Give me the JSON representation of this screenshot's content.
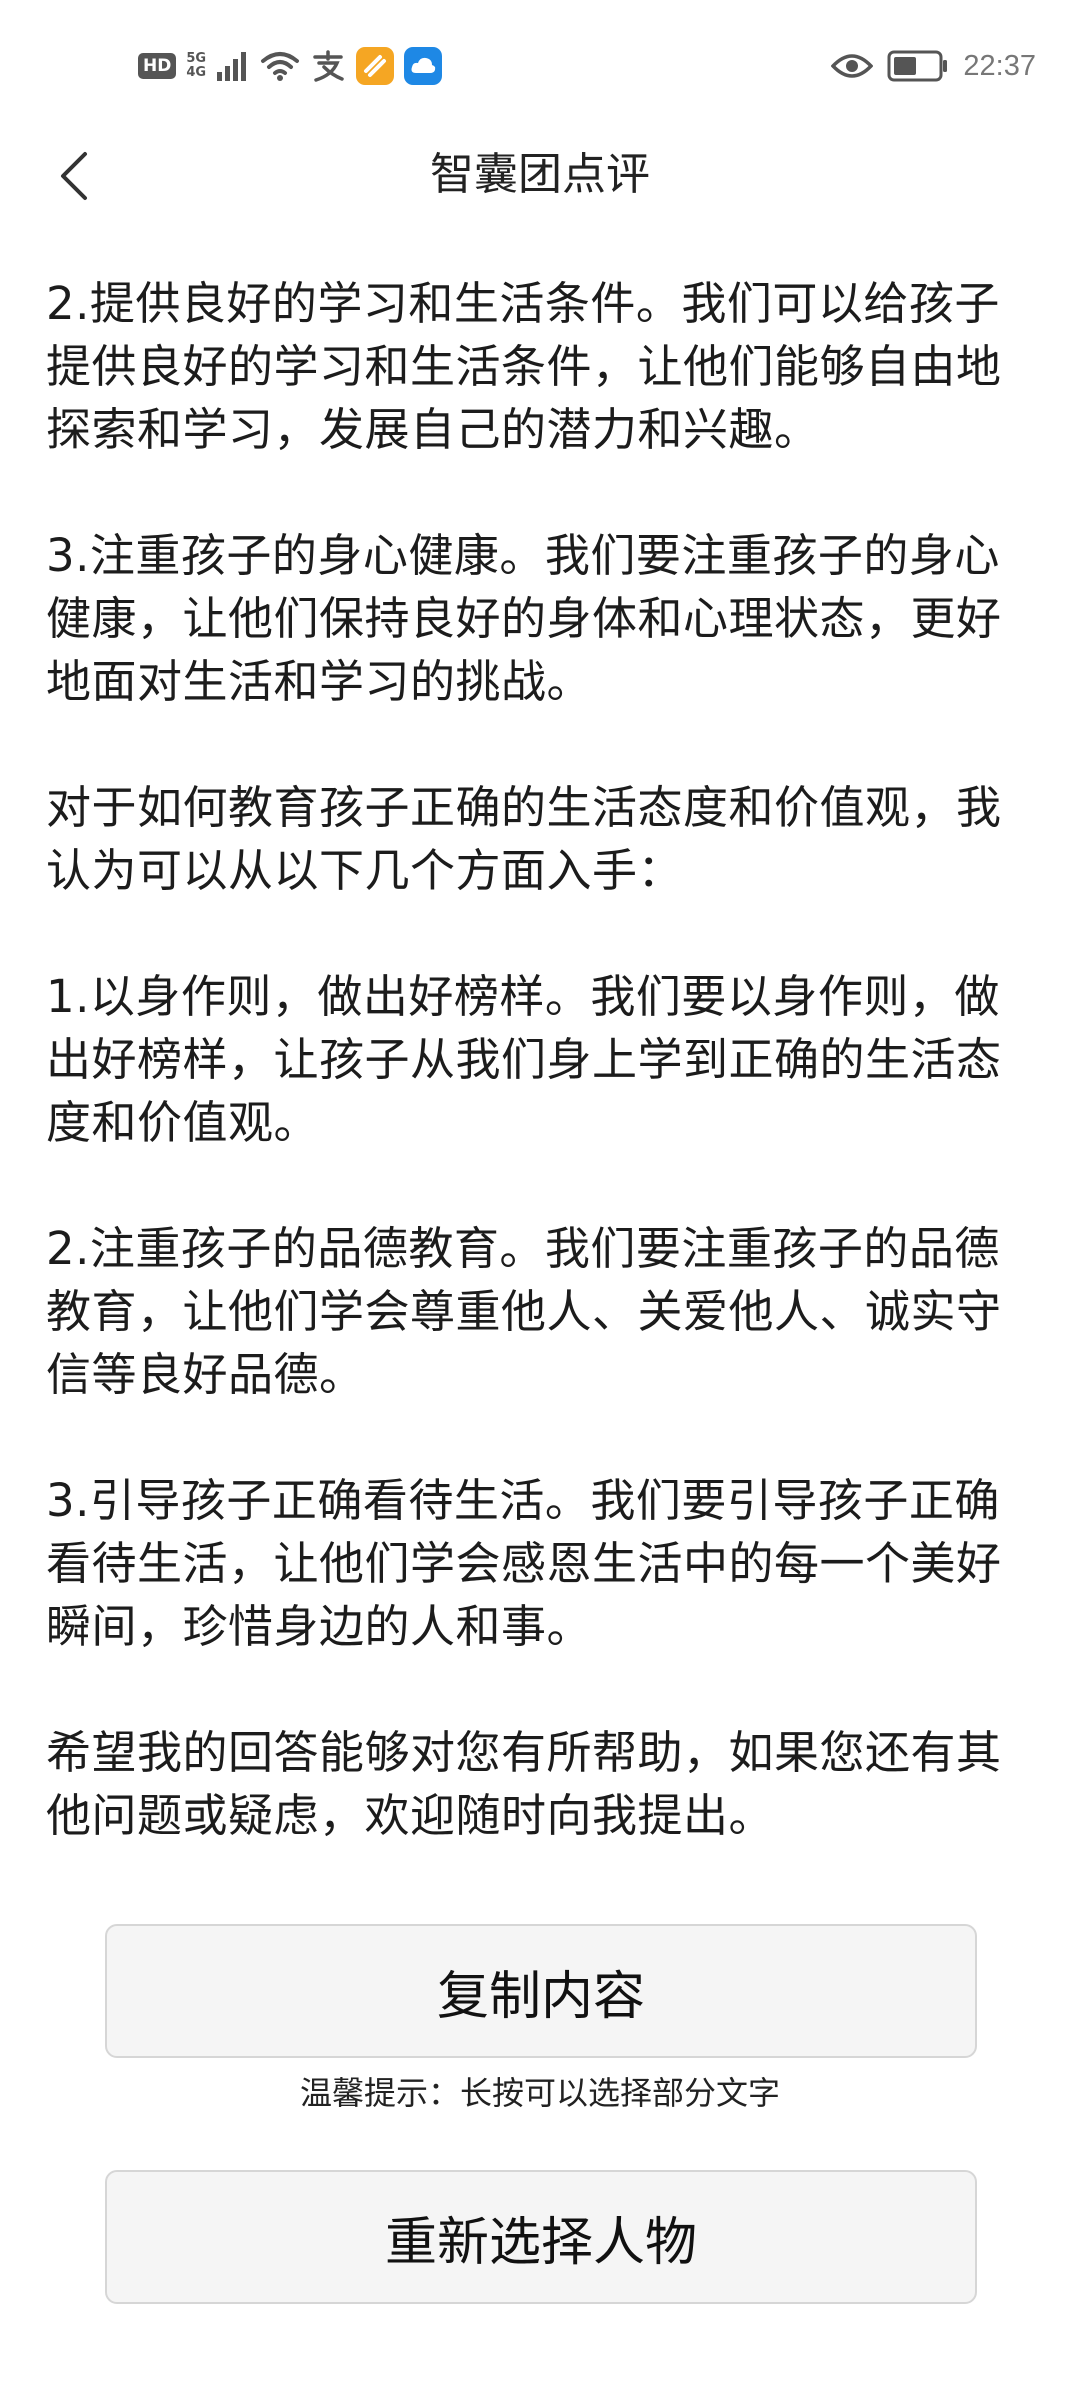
{
  "status_bar": {
    "hd": "HD",
    "network_top": "5G",
    "network_bottom": "4G",
    "time": "22:37"
  },
  "header": {
    "title": "智囊团点评",
    "back_icon": "chevron-left-icon"
  },
  "content": {
    "paragraphs": [
      "2.提供良好的学习和生活条件。我们可以给孩子提供良好的学习和生活条件，让他们能够自由地探索和学习，发展自己的潜力和兴趣。",
      "3.注重孩子的身心健康。我们要注重孩子的身心健康，让他们保持良好的身体和心理状态，更好地面对生活和学习的挑战。",
      "对于如何教育孩子正确的生活态度和价值观，我认为可以从以下几个方面入手：",
      "1.以身作则，做出好榜样。我们要以身作则，做出好榜样，让孩子从我们身上学到正确的生活态度和价值观。",
      "2.注重孩子的品德教育。我们要注重孩子的品德教育，让他们学会尊重他人、关爱他人、诚实守信等良好品德。",
      "3.引导孩子正确看待生活。我们要引导孩子正确看待生活，让他们学会感恩生活中的每一个美好瞬间，珍惜身边的人和事。",
      "希望我的回答能够对您有所帮助，如果您还有其他问题或疑虑，欢迎随时向我提出。"
    ]
  },
  "actions": {
    "copy_label": "复制内容",
    "hint": "温馨提示：长按可以选择部分文字",
    "reselect_label": "重新选择人物"
  },
  "colors": {
    "background": "#ffffff",
    "button_bg": "#f5f5f5",
    "button_border": "#d6d6d6",
    "text": "#1c1c1c",
    "app_orange": "#f5a623",
    "app_blue": "#1e88e5"
  }
}
